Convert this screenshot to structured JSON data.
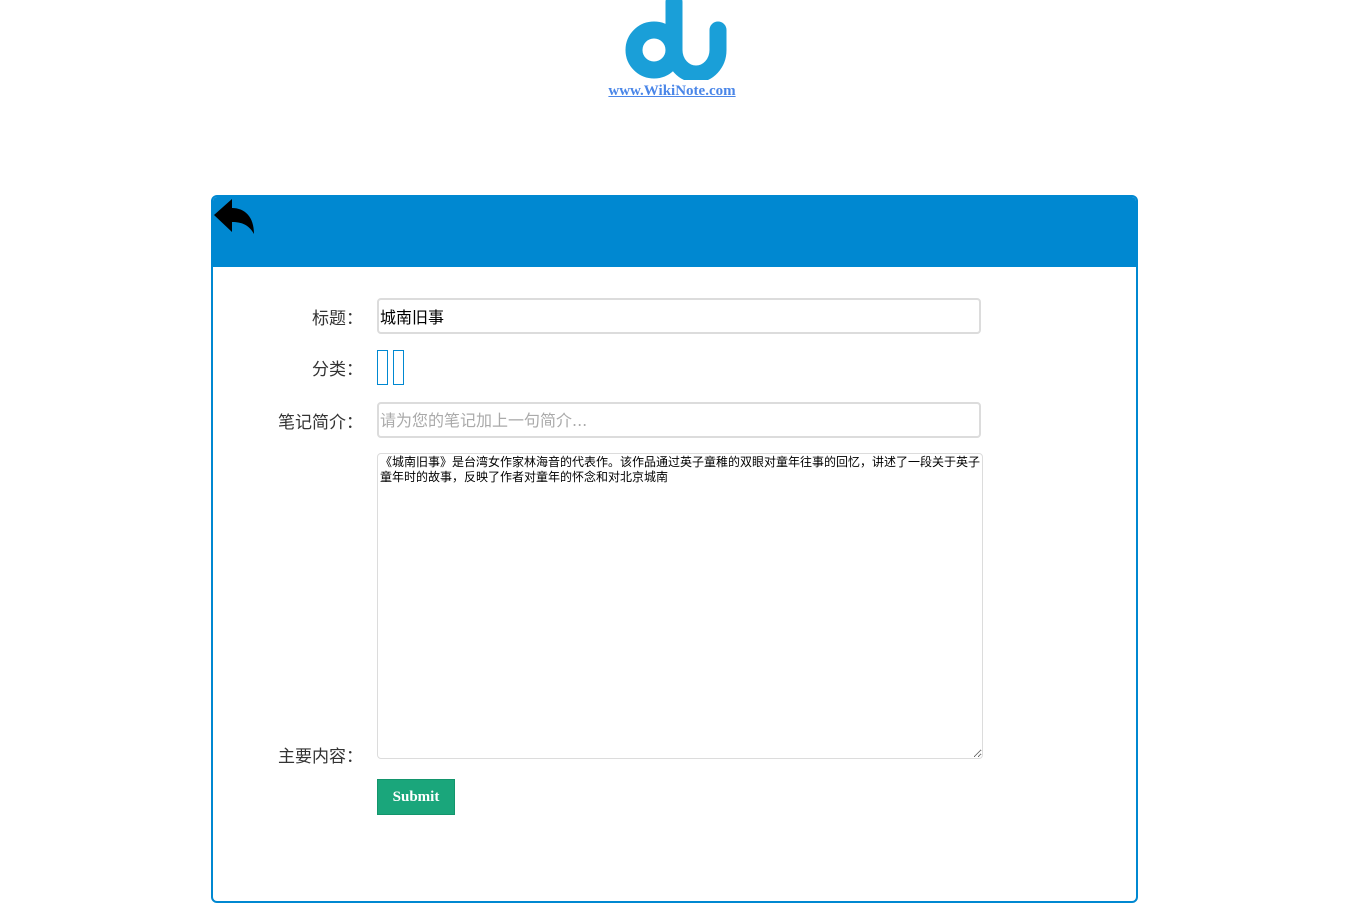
{
  "brand": {
    "logo_icon": "du-logo-icon",
    "logo_color": "#1a9fd8",
    "site_link": "www.WikiNote.com"
  },
  "panel": {
    "accent_color": "#0088d1",
    "back_icon": "reply-arrow-icon"
  },
  "form": {
    "title_label": "标题：",
    "title_value": "城南旧事",
    "category_label": "分类：",
    "summary_label": "笔记简介：",
    "summary_placeholder": "请为您的笔记加上一句简介...",
    "summary_value": "",
    "content_label": "主要内容：",
    "content_value": "《城南旧事》是台湾女作家林海音的代表作。该作品通过英子童稚的双眼对童年往事的回忆，讲述了一段关于英子童年时的故事，反映了作者对童年的怀念和对北京城南",
    "submit_label": "Submit",
    "submit_color": "#1aa67b"
  }
}
